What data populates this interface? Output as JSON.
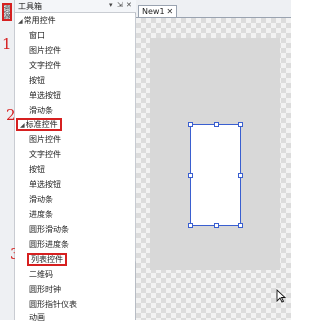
{
  "resource_tab": {
    "label": "资源"
  },
  "annotations": {
    "n1": "1",
    "n2": "2",
    "n3": "3"
  },
  "toolbox": {
    "title": "工具箱",
    "controls": {
      "dropdown": "▾",
      "pin": "⇲",
      "close": "✕"
    },
    "groups": [
      {
        "label": "常用控件",
        "expanded": true,
        "items": [
          "窗口",
          "图片控件",
          "文字控件",
          "按钮",
          "单选按钮",
          "滑动条"
        ]
      },
      {
        "label": "标准控件",
        "expanded": true,
        "highlighted": true,
        "items": [
          "图片控件",
          "文字控件",
          "按钮",
          "单选按钮",
          "滑动条",
          "进度条",
          "圆形滑动条",
          "圆形进度条",
          "列表控件",
          "二维码",
          "圆形时钟",
          "圆形指针仪表",
          "动画"
        ]
      }
    ],
    "highlighted_item": "列表控件"
  },
  "document": {
    "tab_label": "New1",
    "tab_close": "✕"
  },
  "colors": {
    "annotation_red": "#d62020",
    "selection_blue": "#3a5fd0",
    "canvas_gray": "#d8d8d8"
  },
  "icons": [
    "collapse-arrow-icon",
    "close-icon",
    "pin-icon",
    "mouse-cursor-icon"
  ]
}
